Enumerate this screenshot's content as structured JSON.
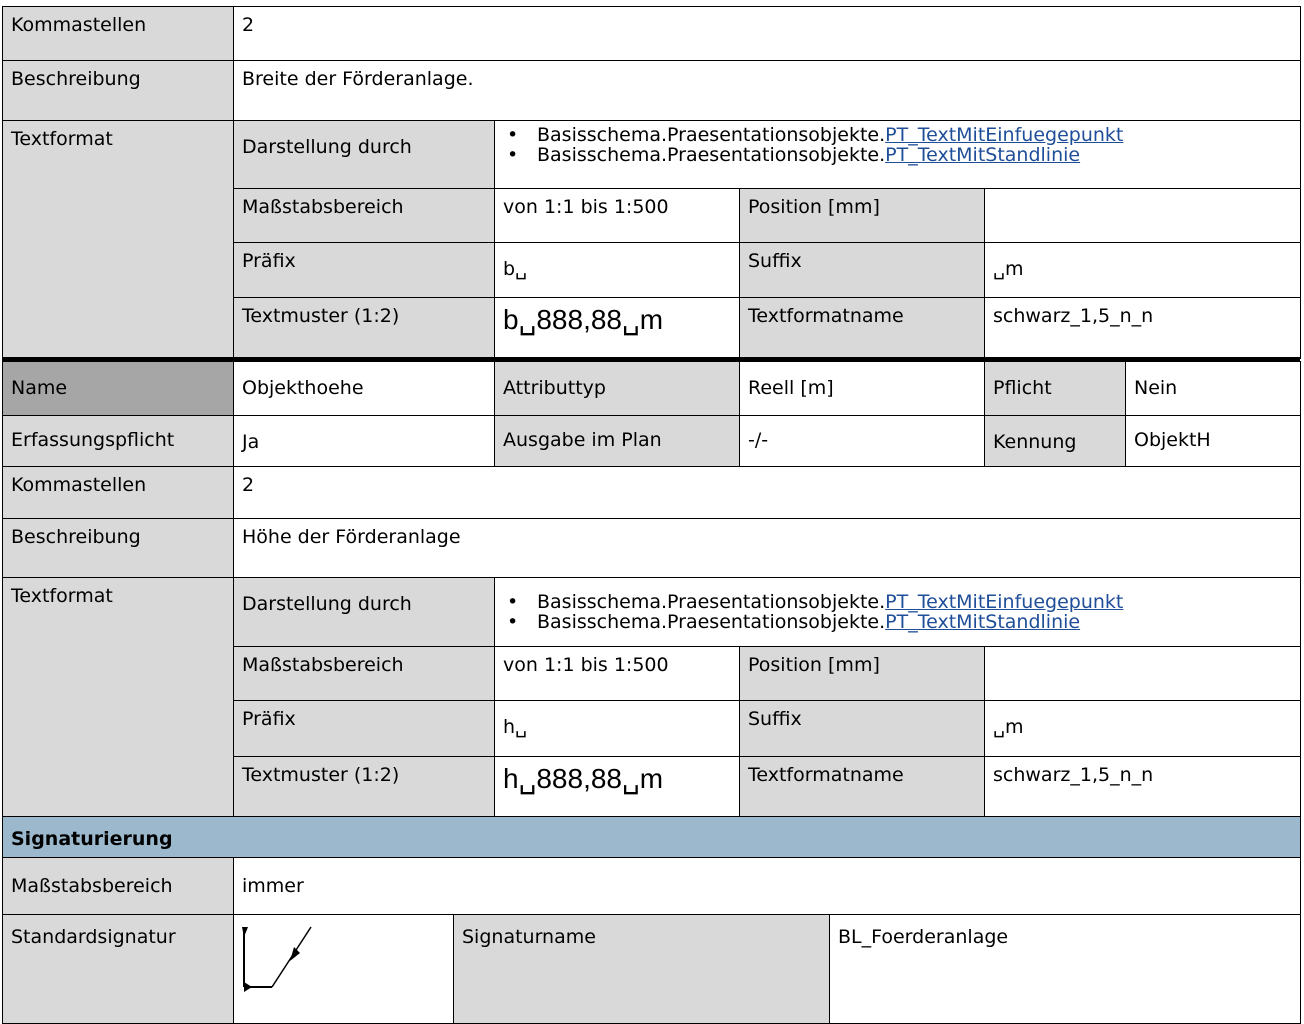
{
  "section1": {
    "kommastellen_label": "Kommastellen",
    "kommastellen_value": "2",
    "beschreibung_label": "Beschreibung",
    "beschreibung_value": "Breite der Förderanlage.",
    "textformat_label": "Textformat",
    "darstellung_label": "Darstellung durch",
    "darstellung_items": [
      {
        "prefix": "Basisschema.Praesentationsobjekte.",
        "link": "PT_TextMitEinfuegepunkt"
      },
      {
        "prefix": "Basisschema.Praesentationsobjekte.",
        "link": "PT_TextMitStandlinie"
      }
    ],
    "massstab_label": "Maßstabsbereich",
    "massstab_value": "von 1:1 bis 1:500",
    "position_label": "Position [mm]",
    "position_value": "",
    "praefix_label": "Präfix",
    "praefix_value": "b␣",
    "suffix_label": "Suffix",
    "suffix_value": "␣m",
    "textmuster_label": "Textmuster (1:2)",
    "textmuster_value": "b␣888,88␣m",
    "textformatname_label": "Textformatname",
    "textformatname_value": "schwarz_1,5_n_n"
  },
  "section2": {
    "name_label": "Name",
    "name_value": "Objekthoehe",
    "attributtyp_label": "Attributtyp",
    "attributtyp_value": "Reell [m]",
    "pflicht_label": "Pflicht",
    "pflicht_value": "Nein",
    "erfassung_label": "Erfassungspflicht",
    "erfassung_value": "Ja",
    "ausgabe_label": "Ausgabe im Plan",
    "ausgabe_value": "-/-",
    "kennung_label": "Kennung",
    "kennung_value": "ObjektH",
    "kommastellen_label": "Kommastellen",
    "kommastellen_value": "2",
    "beschreibung_label": "Beschreibung",
    "beschreibung_value": "Höhe der Förderanlage",
    "textformat_label": "Textformat",
    "darstellung_label": "Darstellung durch",
    "darstellung_items": [
      {
        "prefix": "Basisschema.Praesentationsobjekte.",
        "link": "PT_TextMitEinfuegepunkt"
      },
      {
        "prefix": "Basisschema.Praesentationsobjekte.",
        "link": "PT_TextMitStandlinie"
      }
    ],
    "massstab_label": "Maßstabsbereich",
    "massstab_value": "von 1:1 bis 1:500",
    "position_label": "Position [mm]",
    "position_value": "",
    "praefix_label": "Präfix",
    "praefix_value": "h␣",
    "suffix_label": "Suffix",
    "suffix_value": "␣m",
    "textmuster_label": "Textmuster (1:2)",
    "textmuster_value": "h␣888,88␣m",
    "textformatname_label": "Textformatname",
    "textformatname_value": "schwarz_1,5_n_n"
  },
  "signaturierung": {
    "header": "Signaturierung",
    "massstab_label": "Maßstabsbereich",
    "massstab_value": "immer",
    "standardsignatur_label": "Standardsignatur",
    "signaturname_label": "Signaturname",
    "signaturname_value": "BL_Foerderanlage"
  },
  "colors": {
    "label_gray": "#d9d9d9",
    "name_gray": "#a6a6a6",
    "section_blue": "#9bb8cc",
    "link_blue": "#1f4e99"
  }
}
